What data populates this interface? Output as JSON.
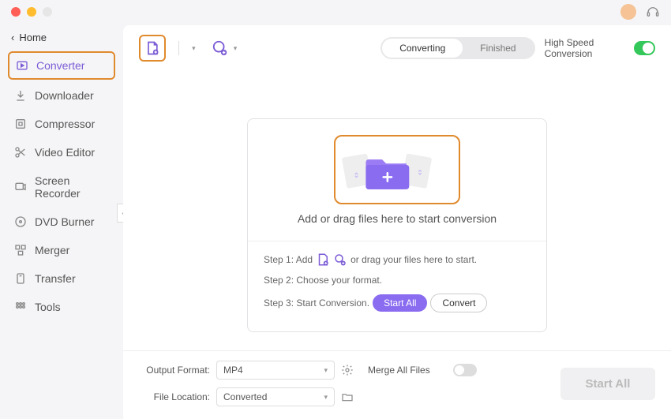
{
  "sidebar": {
    "back_label": "Home",
    "items": [
      {
        "label": "Converter"
      },
      {
        "label": "Downloader"
      },
      {
        "label": "Compressor"
      },
      {
        "label": "Video Editor"
      },
      {
        "label": "Screen Recorder"
      },
      {
        "label": "DVD Burner"
      },
      {
        "label": "Merger"
      },
      {
        "label": "Transfer"
      },
      {
        "label": "Tools"
      }
    ]
  },
  "tabs": {
    "converting": "Converting",
    "finished": "Finished"
  },
  "speed_label": "High Speed Conversion",
  "dropzone": {
    "text": "Add or drag files here to start conversion"
  },
  "steps": {
    "step1_prefix": "Step 1: Add",
    "step1_suffix": "or drag your files here to start.",
    "step2": "Step 2: Choose your format.",
    "step3_prefix": "Step 3: Start Conversion.",
    "start_all": "Start  All",
    "convert": "Convert"
  },
  "footer": {
    "output_label": "Output Format:",
    "output_value": "MP4",
    "location_label": "File Location:",
    "location_value": "Converted",
    "merge_label": "Merge All Files",
    "start_all": "Start All"
  }
}
